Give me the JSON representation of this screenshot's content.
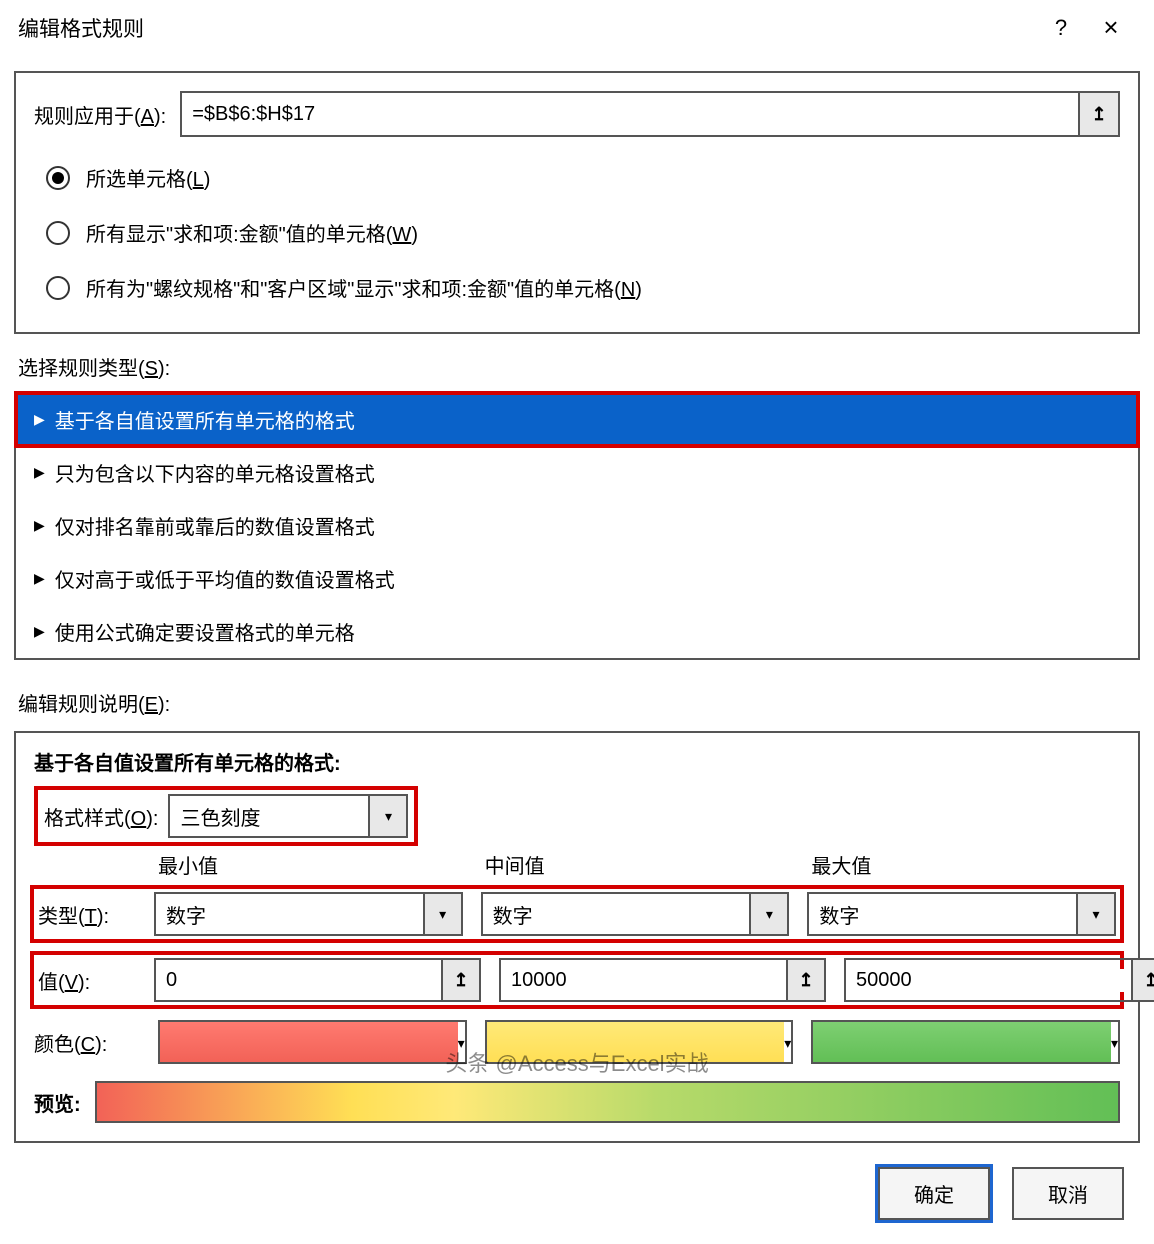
{
  "title": "编辑格式规则",
  "help_icon": "?",
  "close_icon": "×",
  "applies": {
    "label_pre": "规则应用于(",
    "label_key": "A",
    "label_post": "):",
    "range": "=$B$6:$H$17",
    "options": [
      {
        "text_pre": "所选单元格(",
        "key": "L",
        "text_post": ")",
        "selected": true
      },
      {
        "text_pre": "所有显示\"求和项:金额\"值的单元格(",
        "key": "W",
        "text_post": ")",
        "selected": false
      },
      {
        "text_pre": "所有为\"螺纹规格\"和\"客户区域\"显示\"求和项:金额\"值的单元格(",
        "key": "N",
        "text_post": ")",
        "selected": false
      }
    ]
  },
  "ruleTypes": {
    "label_pre": "选择规则类型(",
    "label_key": "S",
    "label_post": "):",
    "items": [
      {
        "text": "基于各自值设置所有单元格的格式",
        "selected": true
      },
      {
        "text": "只为包含以下内容的单元格设置格式",
        "selected": false
      },
      {
        "text": "仅对排名靠前或靠后的数值设置格式",
        "selected": false
      },
      {
        "text": "仅对高于或低于平均值的数值设置格式",
        "selected": false
      },
      {
        "text": "使用公式确定要设置格式的单元格",
        "selected": false
      }
    ]
  },
  "desc": {
    "label_pre": "编辑规则说明(",
    "label_key": "E",
    "label_post": "):",
    "title": "基于各自值设置所有单元格的格式:",
    "style_label_pre": "格式样式(",
    "style_label_key": "O",
    "style_label_post": "):",
    "style_value": "三色刻度",
    "columns": {
      "min": "最小值",
      "mid": "中间值",
      "max": "最大值"
    },
    "type_label_pre": "类型(",
    "type_label_key": "T",
    "type_label_post": "):",
    "type_values": {
      "min": "数字",
      "mid": "数字",
      "max": "数字"
    },
    "value_label_pre": "值(",
    "value_label_key": "V",
    "value_label_post": "):",
    "values": {
      "min": "0",
      "mid": "10000",
      "max": "50000"
    },
    "color_label_pre": "颜色(",
    "color_label_key": "C",
    "color_label_post": "):",
    "preview_label": "预览:"
  },
  "footer": {
    "ok": "确定",
    "cancel": "取消"
  },
  "watermark": "头条 @Access与Excel实战"
}
